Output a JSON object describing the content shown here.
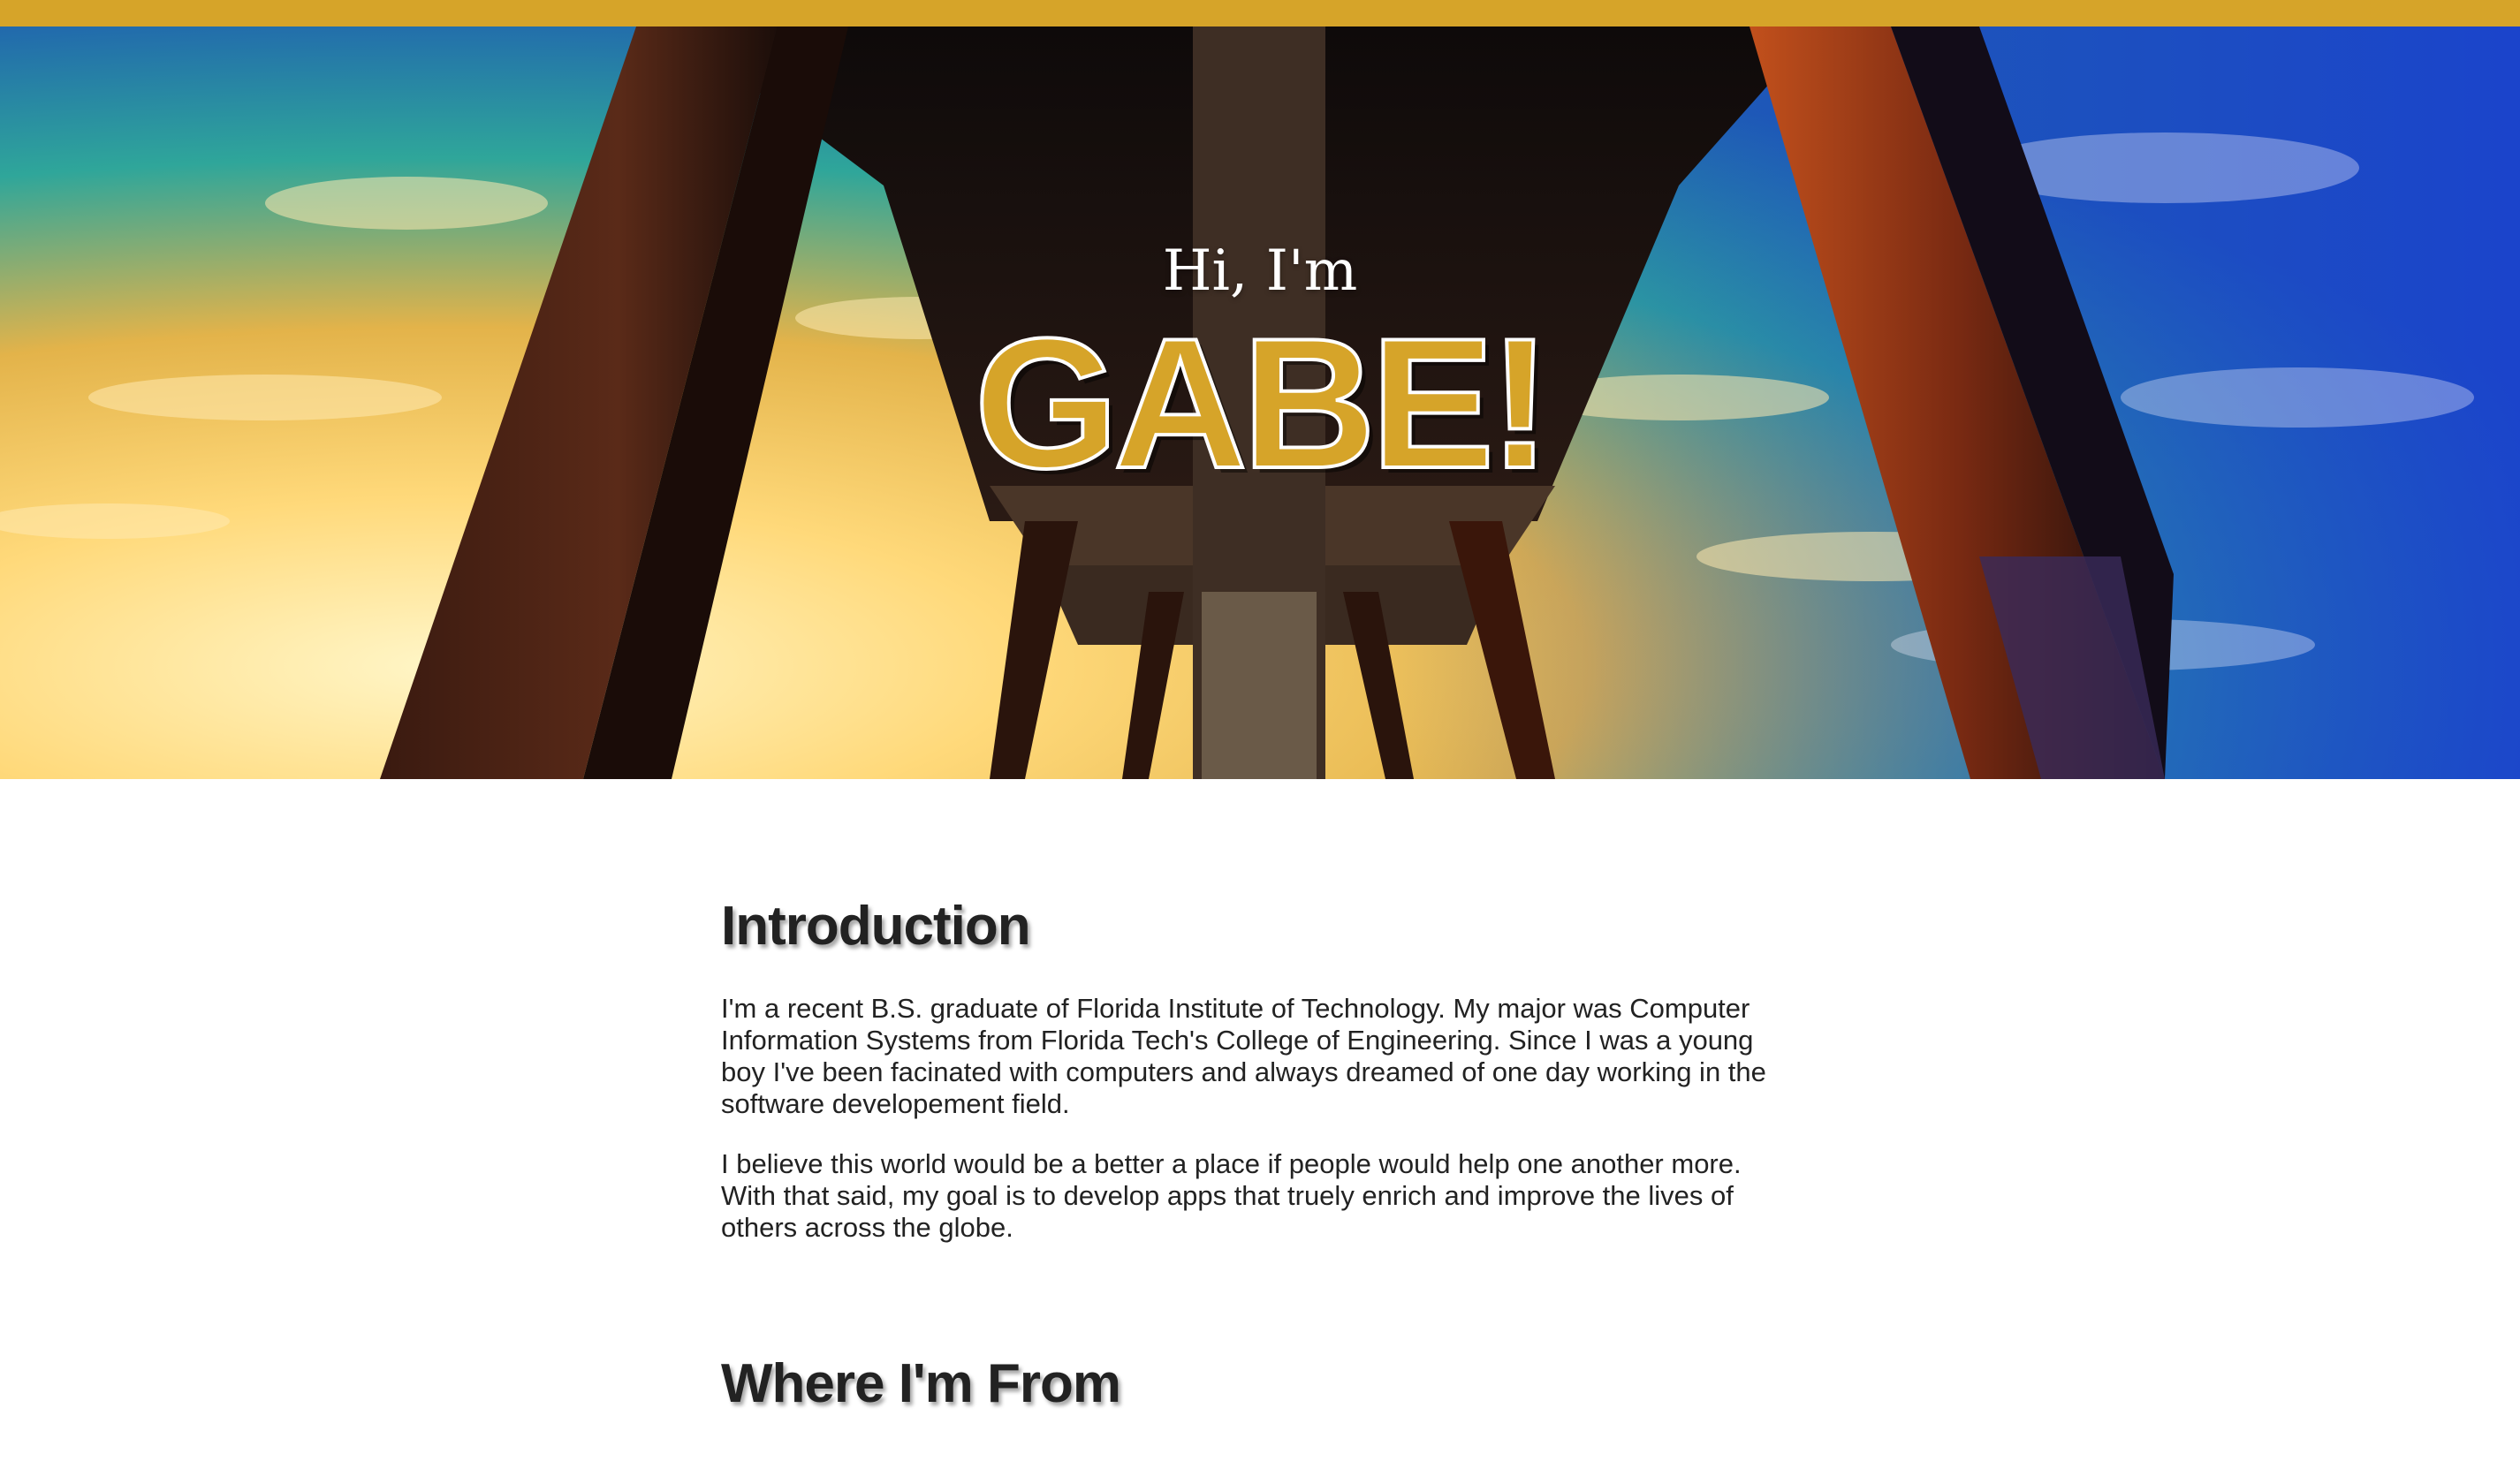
{
  "colors": {
    "accent": "#d6a429",
    "text": "#222222",
    "background": "#ffffff"
  },
  "hero": {
    "greeting": "Hi, I'm",
    "name": "GABE!",
    "background_image": "pier-underside-sunset-photo"
  },
  "intro": {
    "heading": "Introduction",
    "paragraphs": [
      "I'm a recent B.S. graduate of Florida Institute of Technology. My major was Computer Information Systems from Florida Tech's College of Engineering. Since I was a young boy I've been facinated with computers and always dreamed of one day working in the software developement field.",
      "I believe this world would be a better a place if people would help one another more. With that said, my goal is to develop apps that truely enrich and improve the lives of others across the globe."
    ]
  },
  "where_from": {
    "heading": "Where I'm From"
  }
}
